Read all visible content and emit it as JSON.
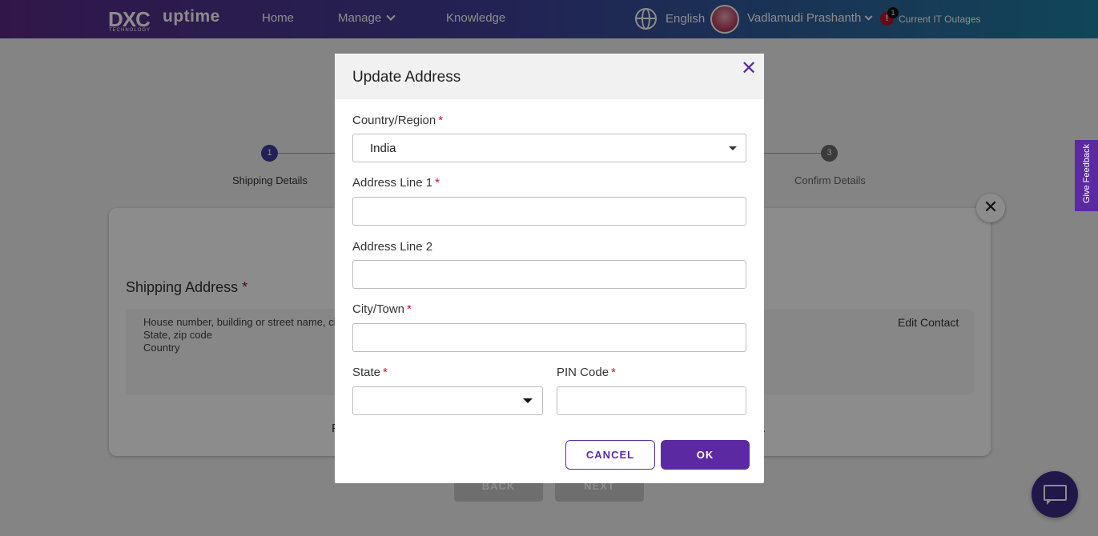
{
  "nav": {
    "brand": "DXC",
    "brand_sub": "TECHNOLOGY",
    "product": "uptime",
    "home": "Home",
    "manage": "Manage",
    "knowledge": "Knowledge",
    "language": "English",
    "user": "Vadlamudi Prashanth",
    "outage_count": "1",
    "outage_icon": "!",
    "outages": "Current IT Outages"
  },
  "steps": {
    "step1_num": "1",
    "step1_label": "Shipping Details",
    "step3_num": "3",
    "step3_label": "Confirm Details"
  },
  "page": {
    "shipping_title": "Shipping Address",
    "required_mark": "*",
    "address_line1": "House number, building or street name, city",
    "address_line2": "State, zip code",
    "address_line3": "Country",
    "edit_contact": "Edit Contact",
    "text_fragment_left": "F",
    "text_fragment_right": ".",
    "back": "BACK",
    "next": "NEXT",
    "close_glyph": "✕"
  },
  "feedback": "Give Feedback",
  "modal": {
    "title": "Update Address",
    "close_glyph": "✕",
    "country_label": "Country/Region",
    "country_value": "India",
    "addr1_label": "Address Line 1",
    "addr1_value": "",
    "addr2_label": "Address Line 2",
    "addr2_value": "",
    "city_label": "City/Town",
    "city_value": "",
    "state_label": "State",
    "state_value": "",
    "pin_label": "PIN Code",
    "pin_value": "",
    "required_mark": "*",
    "cancel": "CANCEL",
    "ok": "OK"
  },
  "colors": {
    "accent": "#5b2aa2",
    "required": "#c8102e",
    "step_active": "#3c3c9e"
  },
  "icons": [
    "globe-icon",
    "chevron-down-icon",
    "alert-icon",
    "close-icon",
    "caret-down-icon",
    "chat-icon"
  ]
}
